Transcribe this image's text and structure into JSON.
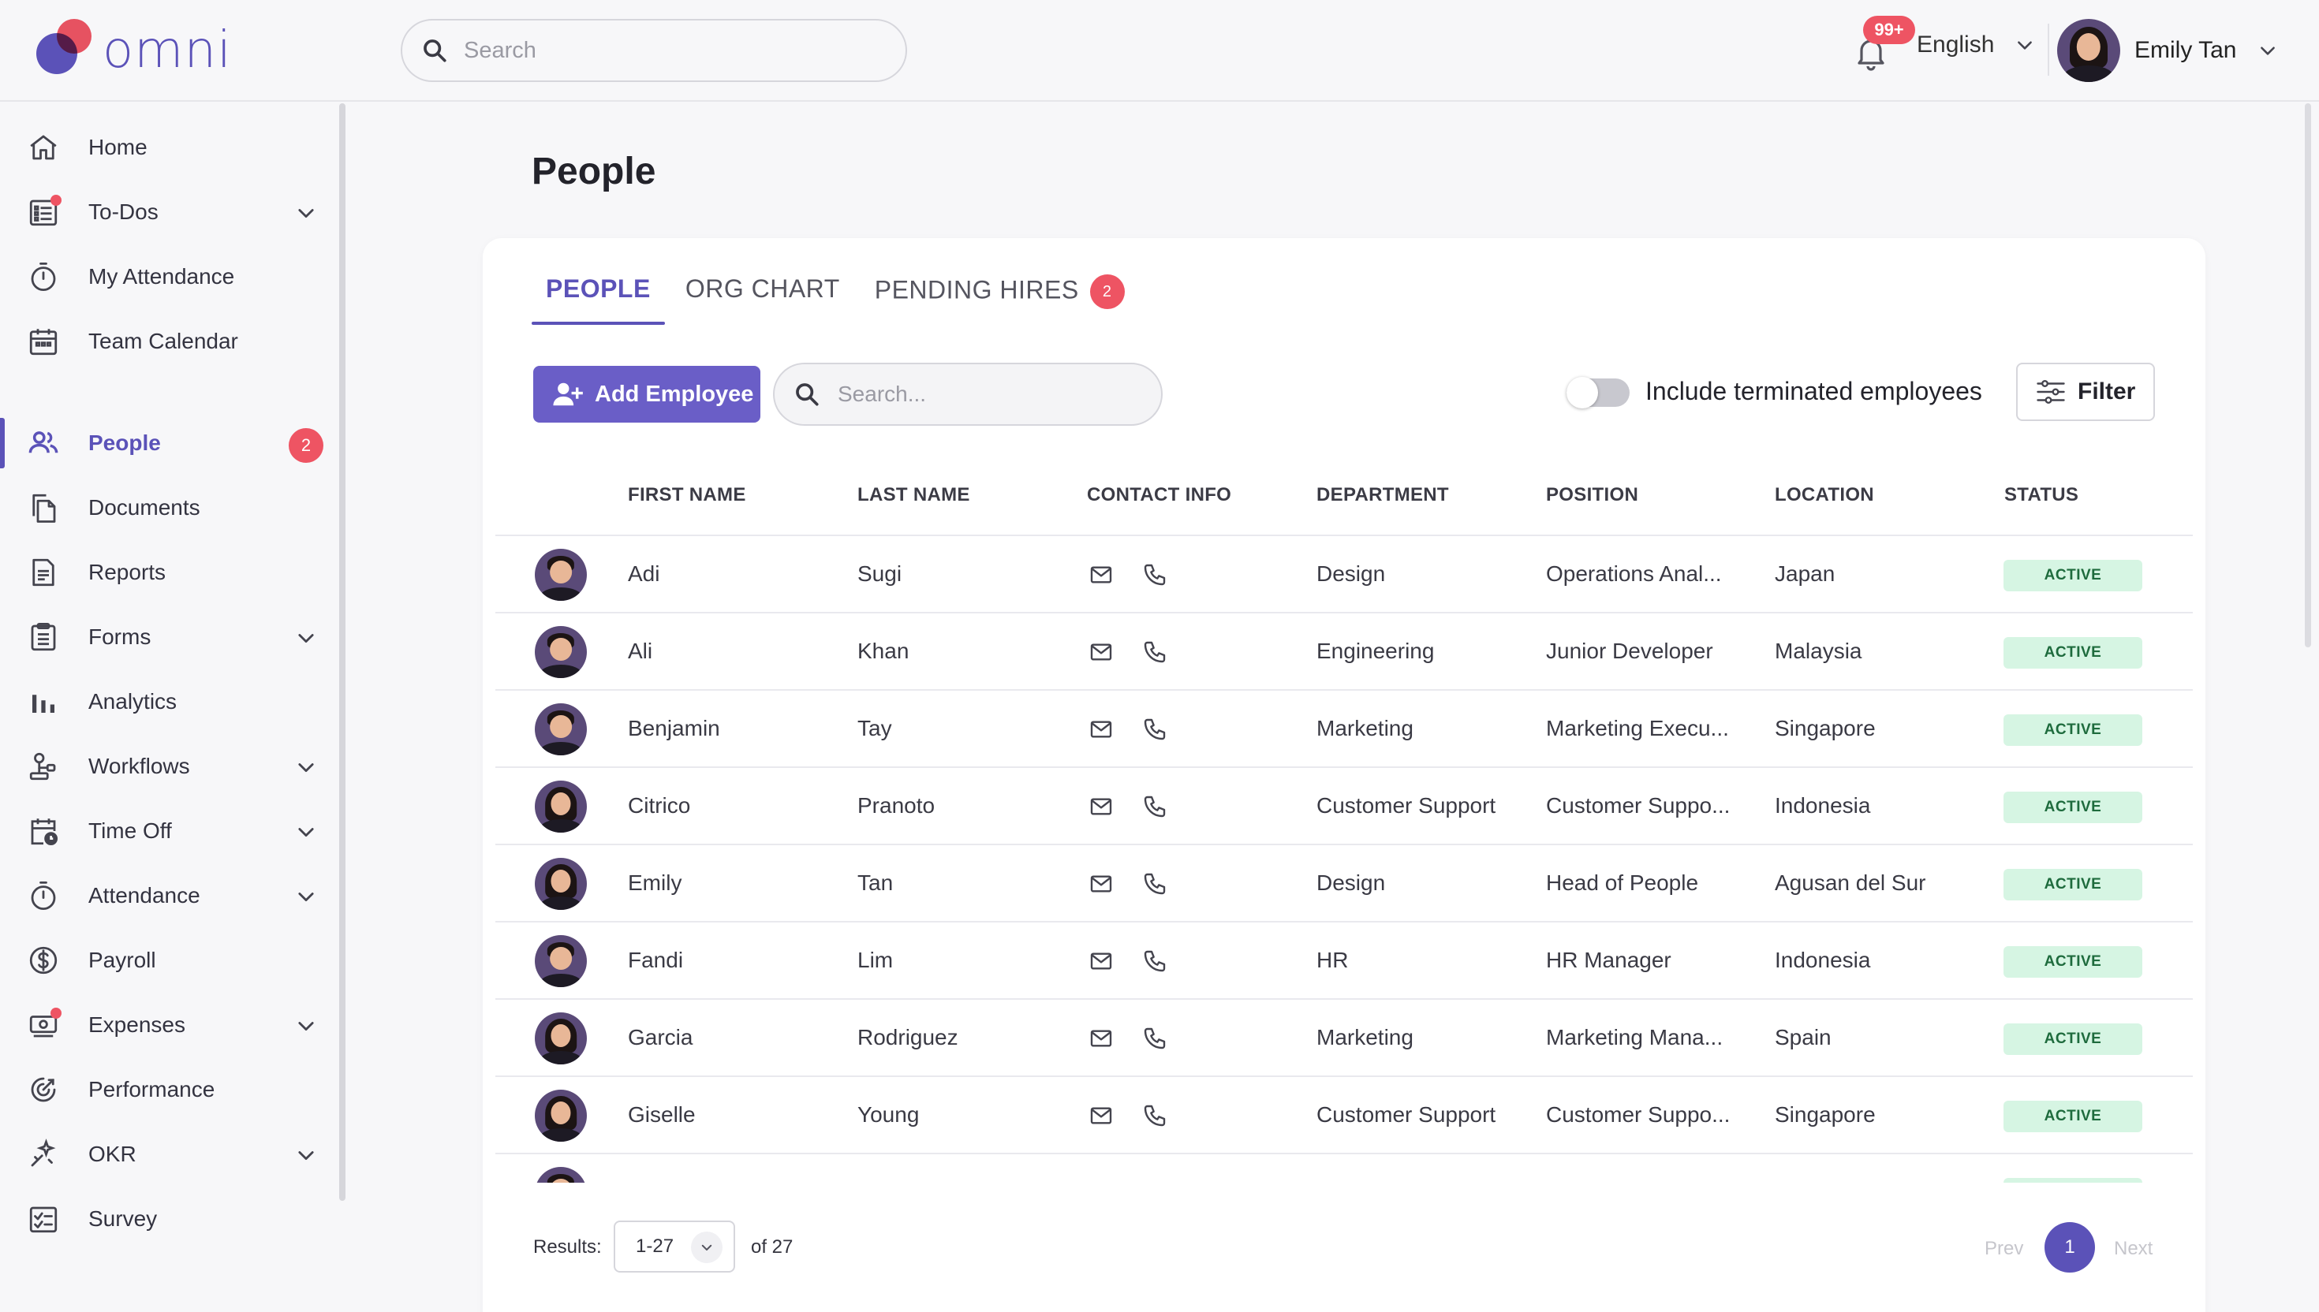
{
  "app": {
    "logo_text": "omni"
  },
  "header": {
    "search_placeholder": "Search",
    "notifications_badge": "99+",
    "language": "English",
    "user_name": "Emily Tan"
  },
  "sidebar": {
    "items": [
      {
        "label": "Home",
        "icon": "home-icon"
      },
      {
        "label": "To-Dos",
        "icon": "todo-list-icon",
        "has_dot": true,
        "expandable": true
      },
      {
        "label": "My Attendance",
        "icon": "stopwatch-icon"
      },
      {
        "label": "Team Calendar",
        "icon": "calendar-icon"
      },
      {
        "label": "People",
        "icon": "people-icon",
        "active": true,
        "badge": "2"
      },
      {
        "label": "Documents",
        "icon": "documents-icon"
      },
      {
        "label": "Reports",
        "icon": "report-icon"
      },
      {
        "label": "Forms",
        "icon": "clipboard-icon",
        "expandable": true
      },
      {
        "label": "Analytics",
        "icon": "bar-chart-icon"
      },
      {
        "label": "Workflows",
        "icon": "workflow-icon",
        "expandable": true
      },
      {
        "label": "Time Off",
        "icon": "calendar-clock-icon",
        "expandable": true
      },
      {
        "label": "Attendance",
        "icon": "stopwatch-icon",
        "expandable": true
      },
      {
        "label": "Payroll",
        "icon": "dollar-circle-icon"
      },
      {
        "label": "Expenses",
        "icon": "cash-icon",
        "has_dot": true,
        "expandable": true
      },
      {
        "label": "Performance",
        "icon": "target-icon"
      },
      {
        "label": "OKR",
        "icon": "sparkle-icon",
        "expandable": true
      },
      {
        "label": "Survey",
        "icon": "survey-icon"
      }
    ]
  },
  "page": {
    "title": "People",
    "tabs": [
      {
        "label": "PEOPLE",
        "active": true
      },
      {
        "label": "ORG CHART"
      },
      {
        "label": "PENDING HIRES",
        "badge": "2"
      }
    ],
    "add_employee_label": "Add Employee",
    "employee_search_placeholder": "Search...",
    "include_terminated_label": "Include terminated employees",
    "filter_label": "Filter"
  },
  "table": {
    "columns": [
      "FIRST NAME",
      "LAST NAME",
      "CONTACT INFO",
      "DEPARTMENT",
      "POSITION",
      "LOCATION",
      "STATUS"
    ],
    "rows": [
      {
        "first": "Adi",
        "last": "Sugi",
        "department": "Design",
        "position": "Operations Anal...",
        "location": "Japan",
        "status": "ACTIVE",
        "gender": "male"
      },
      {
        "first": "Ali",
        "last": "Khan",
        "department": "Engineering",
        "position": "Junior Developer",
        "location": "Malaysia",
        "status": "ACTIVE",
        "gender": "male"
      },
      {
        "first": "Benjamin",
        "last": "Tay",
        "department": "Marketing",
        "position": "Marketing Execu...",
        "location": "Singapore",
        "status": "ACTIVE",
        "gender": "male"
      },
      {
        "first": "Citrico",
        "last": "Pranoto",
        "department": "Customer Support",
        "position": "Customer Suppo...",
        "location": "Indonesia",
        "status": "ACTIVE",
        "gender": "female"
      },
      {
        "first": "Emily",
        "last": "Tan",
        "department": "Design",
        "position": "Head of People",
        "location": "Agusan del Sur",
        "status": "ACTIVE",
        "gender": "female"
      },
      {
        "first": "Fandi",
        "last": "Lim",
        "department": "HR",
        "position": "HR Manager",
        "location": "Indonesia",
        "status": "ACTIVE",
        "gender": "male"
      },
      {
        "first": "Garcia",
        "last": "Rodriguez",
        "department": "Marketing",
        "position": "Marketing Mana...",
        "location": "Spain",
        "status": "ACTIVE",
        "gender": "female"
      },
      {
        "first": "Giselle",
        "last": "Young",
        "department": "Customer Support",
        "position": "Customer Suppo...",
        "location": "Singapore",
        "status": "ACTIVE",
        "gender": "female"
      }
    ]
  },
  "pagination": {
    "results_label": "Results:",
    "range": "1-27",
    "of_total": "of 27",
    "prev_label": "Prev",
    "current_page": "1",
    "next_label": "Next"
  }
}
